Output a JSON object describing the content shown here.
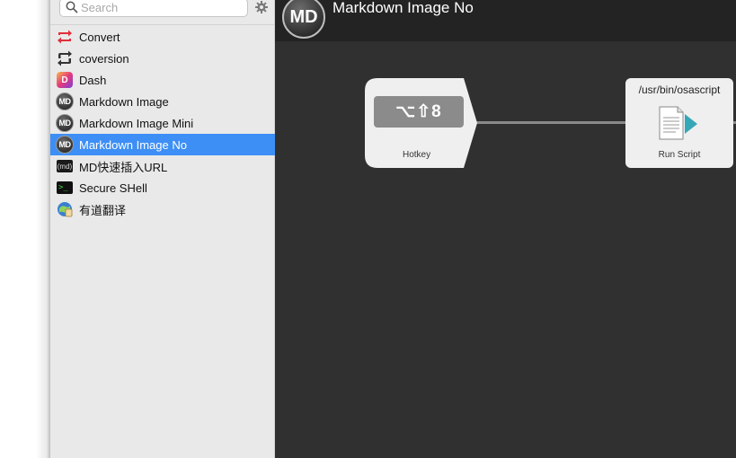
{
  "search": {
    "placeholder": "Search"
  },
  "sidebar": {
    "items": [
      {
        "label": "Convert",
        "icon": "convert-icon"
      },
      {
        "label": "coversion",
        "icon": "repeat-icon"
      },
      {
        "label": "Dash",
        "icon": "dash-icon"
      },
      {
        "label": "Markdown Image",
        "icon": "md-icon"
      },
      {
        "label": "Markdown Image Mini",
        "icon": "md-icon"
      },
      {
        "label": "Markdown Image No",
        "icon": "md-icon",
        "selected": true
      },
      {
        "label": "MD快速插入URL",
        "icon": "md-square-icon"
      },
      {
        "label": "Secure SHell",
        "icon": "terminal-icon"
      },
      {
        "label": "有道翻译",
        "icon": "youdao-icon"
      }
    ]
  },
  "header": {
    "logo": "MD",
    "title": "Markdown Image No"
  },
  "nodes": {
    "hotkey": {
      "keys": "⌥⇧8",
      "label": "Hotkey"
    },
    "script": {
      "path": "/usr/bin/osascript",
      "label": "Run Script"
    }
  },
  "icons": {
    "md_badge": "MD",
    "md_square": "(md)",
    "terminal": ">_",
    "dash": "D"
  },
  "colors": {
    "selection": "#3d8ff5",
    "canvas": "#303030",
    "header": "#232323",
    "convert": "#e0303a"
  }
}
